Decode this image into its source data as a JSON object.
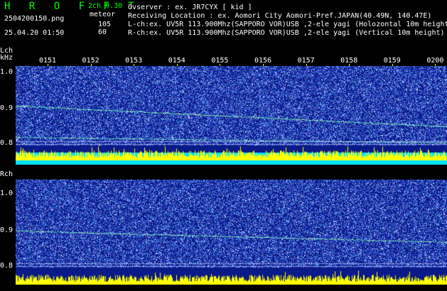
{
  "header": {
    "app_title": "H R O F F T",
    "mode": "2ch 0.30",
    "filename": "2504200150.png",
    "meteor_label": "meteor",
    "count_l": "105",
    "count_r": "60",
    "timestamp": "25.04.20 01:50"
  },
  "info": {
    "observer": "Ovserver             : ex. JR7CYX [ kid ]",
    "location": "Receiving Location : ex. Aomori City Aomori-Pref.JAPAN(40.49N, 140.47E)",
    "lch": "L-ch:ex. UV5R 113.900Mhz(SAPPORO VOR)USB ,2-ele yagi (Holozontal 10m height",
    "rch": "R-ch:ex. UV5R 113.900Mhz(SAPPORO VOR)USB ,2-ele yagi (Vertical 10m height)"
  },
  "time_axis": {
    "labels": [
      "0151",
      "0152",
      "0153",
      "0154",
      "0155",
      "0156",
      "0157",
      "0158",
      "0159",
      "0200"
    ]
  },
  "panels": {
    "lch": {
      "channel_label": "Lch",
      "unit_label": "kHz",
      "ticks": [
        "1.0",
        "0.9",
        "0.8"
      ]
    },
    "rch": {
      "channel_label": "Rch",
      "ticks": [
        "1.0",
        "0.9",
        "0.8"
      ]
    }
  },
  "colors": {
    "background": "#000000",
    "panel_bg": "#0a1a88",
    "title_green": "#00ff00",
    "bar_yellow": "#ffff00",
    "bar_cyan": "#00e0ff",
    "signal_line": "#40e0c0"
  }
}
